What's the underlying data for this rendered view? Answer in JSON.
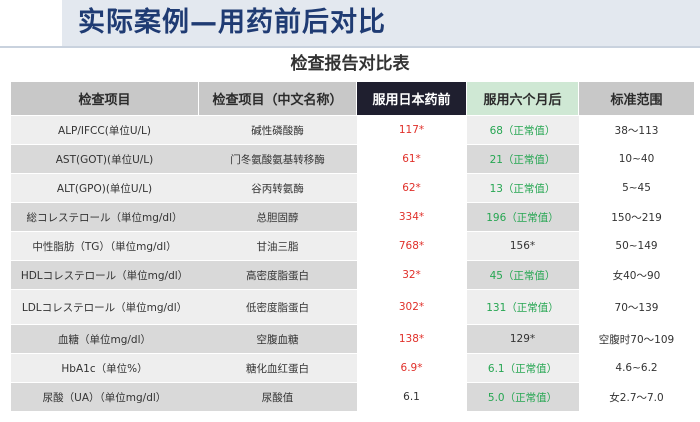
{
  "slide": {
    "title": "实际案例—用药前后对比"
  },
  "table": {
    "title": "检查报告对比表",
    "headers": [
      "检查项目",
      "检查项目（中文名称）",
      "服用日本药前",
      "服用六个月后",
      "标准范围"
    ],
    "rows": [
      {
        "item": "ALP/IFCC(单位U/L)",
        "cn": "碱性磷酸酶",
        "before": "117*",
        "after": "68（正常值）",
        "after_status": "normal",
        "range": "38～113"
      },
      {
        "item": "AST(GOT)(单位U/L)",
        "cn": "门冬氨酸氨基转移酶",
        "before": "61*",
        "after": "21（正常值）",
        "after_status": "normal",
        "range": "10~40"
      },
      {
        "item": "ALT(GPO)(单位U/L)",
        "cn": "谷丙转氨酶",
        "before": "62*",
        "after": "13（正常值）",
        "after_status": "normal",
        "range": "5~45"
      },
      {
        "item": "総コレステロール（単位mg/dl）",
        "cn": "总胆固醇",
        "before": "334*",
        "after": "196（正常值）",
        "after_status": "normal",
        "range": "150～219"
      },
      {
        "item": "中性脂肪（TG）（単位mg/dl）",
        "cn": "甘油三脂",
        "before": "768*",
        "after": "156*",
        "after_status": "abnormal",
        "range": "50~149"
      },
      {
        "item": "HDLコレステロール（単位mg/dl）",
        "cn": "高密度脂蛋白",
        "before": "32*",
        "after": "45（正常值）",
        "after_status": "normal",
        "range": "女40～90"
      },
      {
        "item": "LDLコレステロール（単位mg/dl）",
        "cn": "低密度脂蛋白",
        "before": "302*",
        "after": "131（正常值）",
        "after_status": "normal",
        "range": "70～139"
      },
      {
        "item": "血糖（单位mg/dl）",
        "cn": "空腹血糖",
        "before": "138*",
        "after": "129*",
        "after_status": "abnormal",
        "range": "空腹时70～109"
      },
      {
        "item": "HbA1c（单位%）",
        "cn": "糖化血红蛋白",
        "before": "6.9*",
        "after": "6.1（正常值）",
        "after_status": "normal",
        "range": "4.6~6.2"
      },
      {
        "item": "尿酸（UA）（单位mg/dl）",
        "cn": "尿酸值",
        "before": "6.1",
        "after": "5.0（正常值）",
        "after_status": "normal",
        "range": "女2.7～7.0"
      }
    ]
  },
  "colors": {
    "abnormal": "#e0302a",
    "normal": "#26a652",
    "title": "#1f3b73"
  }
}
